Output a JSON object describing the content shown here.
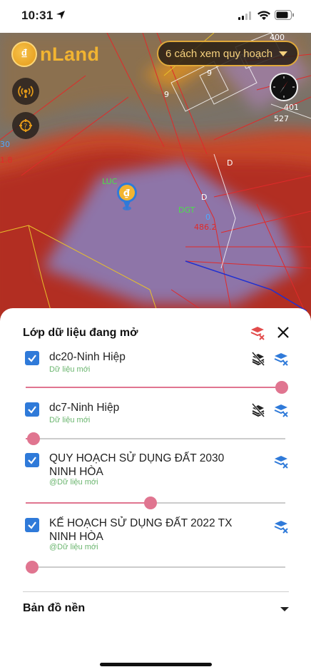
{
  "status_bar": {
    "time": "10:31"
  },
  "map": {
    "logo_text": "nLand",
    "view_dropdown_label": "6 cách xem quy hoạch",
    "parcel_labels": [
      "400",
      "9",
      "9",
      "401",
      "527",
      "D",
      "D",
      "LUC",
      "DGT",
      "0",
      "486.2",
      "30",
      "1.8"
    ],
    "icons": [
      "broadcast-icon",
      "locate-icon",
      "compass-icon",
      "map-pin-icon"
    ]
  },
  "sheet": {
    "title": "Lớp dữ liệu đang mở",
    "layers": [
      {
        "name": "dc20-Ninh Hiệp",
        "sub": "Dữ liệu mới",
        "checked": true,
        "opacity": 1.0
      },
      {
        "name": "dc7-Ninh Hiệp",
        "sub": "Dữ liệu mới",
        "checked": true,
        "opacity": 0.03
      },
      {
        "name_line1": "QUY HOẠCH SỬ DỤNG ĐẤT 2030",
        "name_line2": "NINH HÒA",
        "sub": "@Dữ liệu mới",
        "checked": true,
        "opacity": 0.48
      },
      {
        "name_line1": "KẾ HOẠCH SỬ DỤNG ĐẤT 2022 TX",
        "name_line2": "NINH HÒA",
        "sub": "@Dữ liệu mới",
        "checked": true,
        "opacity": 0.01
      }
    ],
    "basemap_label": "Bản đồ nền"
  },
  "colors": {
    "accent": "#2f7ad9",
    "slider": "#e07590",
    "brand": "#f2b431"
  }
}
